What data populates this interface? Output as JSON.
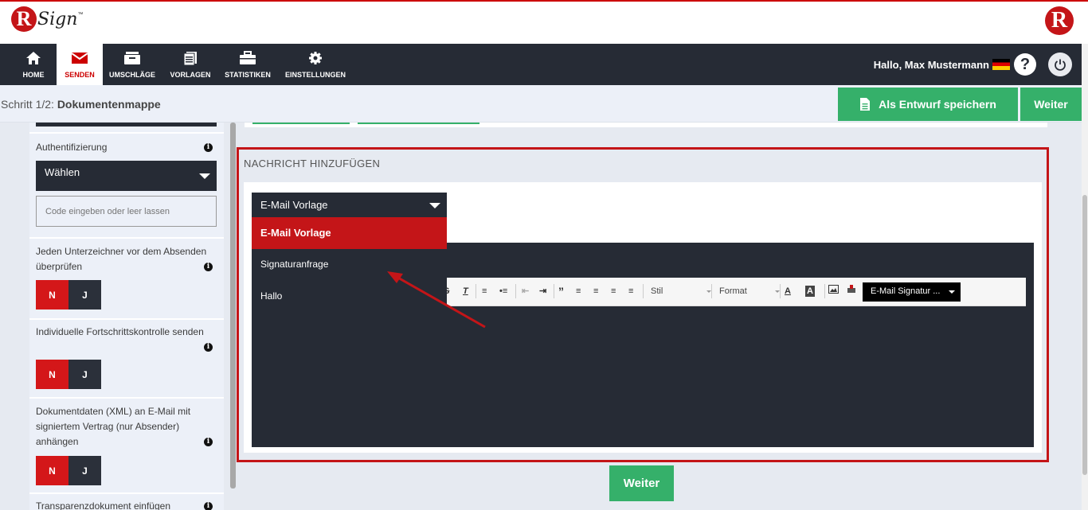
{
  "logo": {
    "brand": "RSign",
    "mark": "R",
    "text": "Sign",
    "tm": "™"
  },
  "nav": {
    "items": [
      {
        "label": "HOME",
        "icon": "home-icon"
      },
      {
        "label": "SENDEN",
        "icon": "envelope-icon",
        "active": true
      },
      {
        "label": "UMSCHLÄGE",
        "icon": "archive-box-icon"
      },
      {
        "label": "VORLAGEN",
        "icon": "documents-icon"
      },
      {
        "label": "STATISTIKEN",
        "icon": "briefcase-icon"
      },
      {
        "label": "EINSTELLUNGEN",
        "icon": "gear-icon"
      }
    ],
    "greeting": "Hallo, Max Mustermann",
    "help": "?"
  },
  "subheader": {
    "step_prefix": "Schritt 1/2:",
    "step_title": "Dokumentenmappe",
    "save_draft": "Als Entwurf speichern",
    "next": "Weiter"
  },
  "sidebar": {
    "authentication": {
      "label": "Authentifizierung",
      "select_value": "Wählen",
      "code_placeholder": "Code eingeben oder leer lassen"
    },
    "review_signers": {
      "label_line1": "Jeden Unterzeichner vor dem Absenden",
      "label_line2": "überprüfen",
      "no": "N",
      "yes": "J"
    },
    "progress_control": {
      "label": "Individuelle Fortschrittskontrolle senden",
      "no": "N",
      "yes": "J"
    },
    "xml_data": {
      "label_line1": "Dokumentdaten (XML) an E-Mail mit",
      "label_line2": "signiertem Vertrag (nur Absender)",
      "label_line3": "anhängen",
      "no": "N",
      "yes": "J"
    },
    "transparency": {
      "label": "Transparenzdokument einfügen"
    }
  },
  "message": {
    "title": "NACHRICHT HINZUFÜGEN",
    "template_select": "E-Mail Vorlage",
    "options": [
      "E-Mail Vorlage",
      "Signaturanfrage",
      "Hallo"
    ],
    "toolbar": {
      "style_label": "Stil",
      "format_label": "Format",
      "signature_dropdown": "E-Mail Signatur ..."
    },
    "next": "Weiter"
  },
  "colors": {
    "brand_red": "#c41518",
    "nav_dark": "#262b35",
    "green": "#35b06a"
  }
}
